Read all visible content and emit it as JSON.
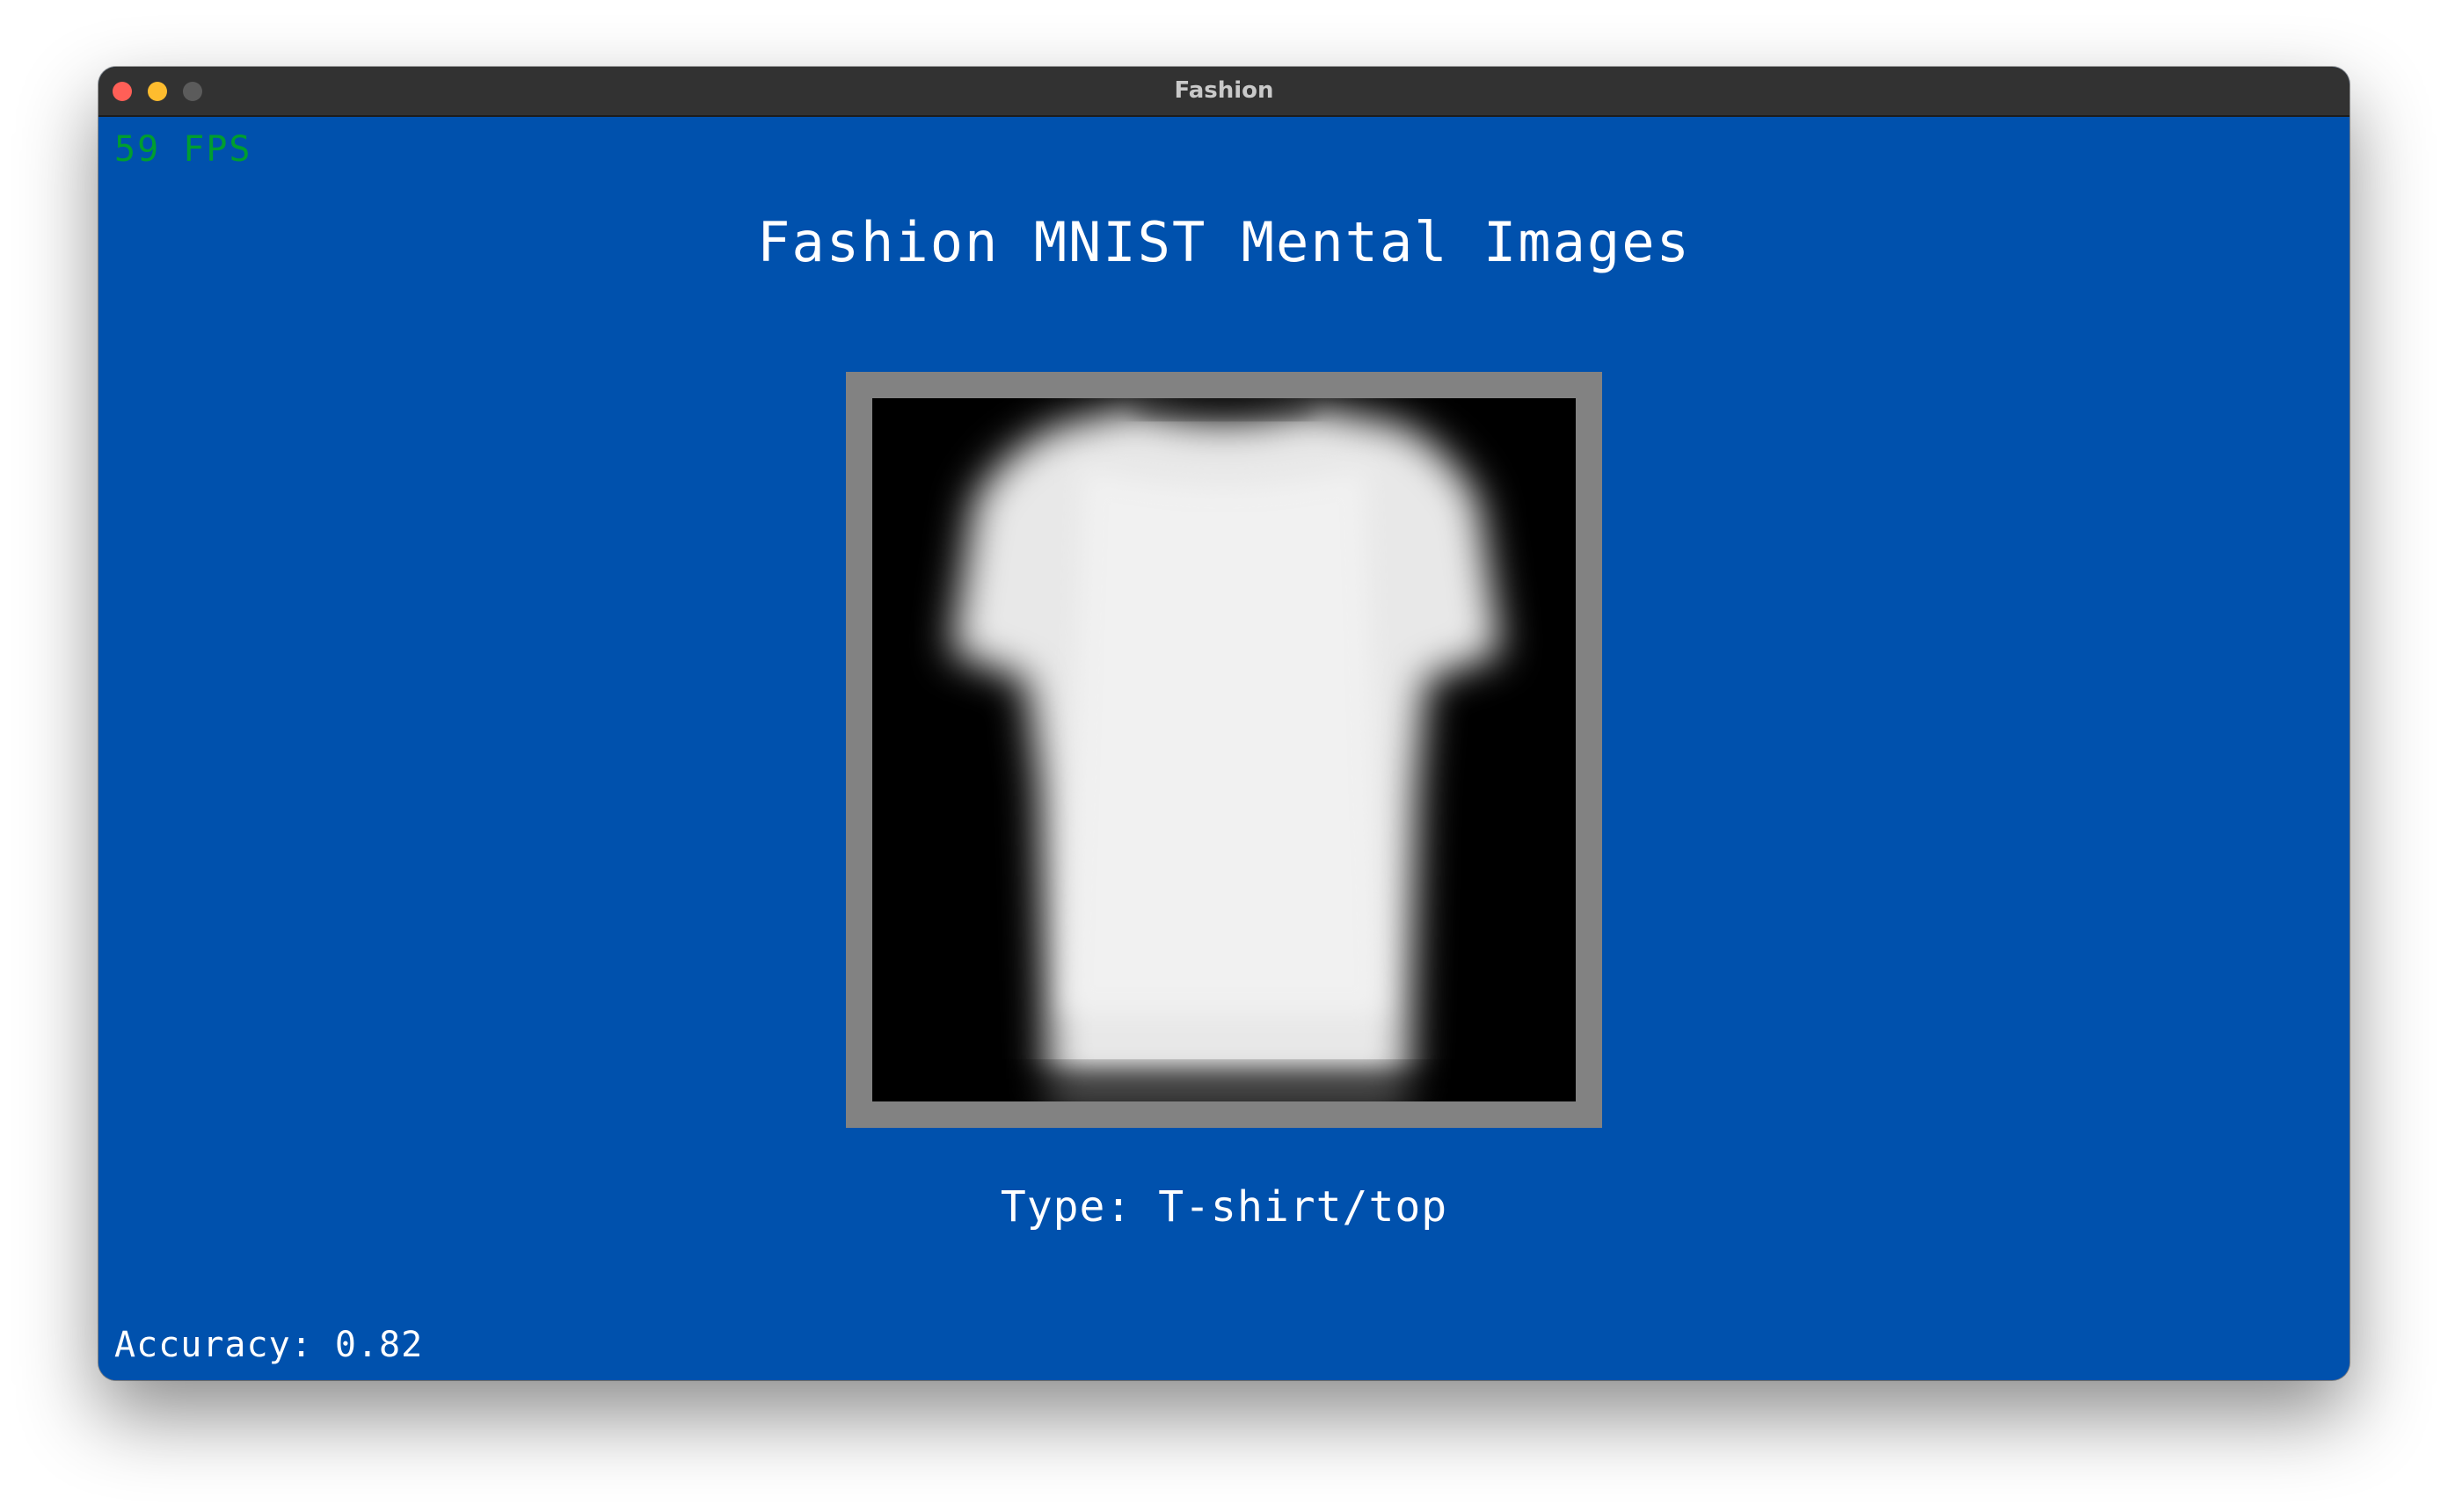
{
  "window": {
    "title": "Fashion"
  },
  "hud": {
    "fps": "59 FPS",
    "accuracy": "Accuracy: 0.82"
  },
  "main": {
    "title": "Fashion MNIST Mental Images",
    "type_label": "Type: T-shirt/top"
  },
  "image": {
    "icon": "tshirt-mental-image",
    "foreground_color": "#f0f0f0",
    "background_color": "#000000",
    "frame_color": "#828282"
  },
  "colors": {
    "background": "#0051ad",
    "fps_text": "#009e2f",
    "text": "#ffffff",
    "titlebar": "#323232"
  }
}
